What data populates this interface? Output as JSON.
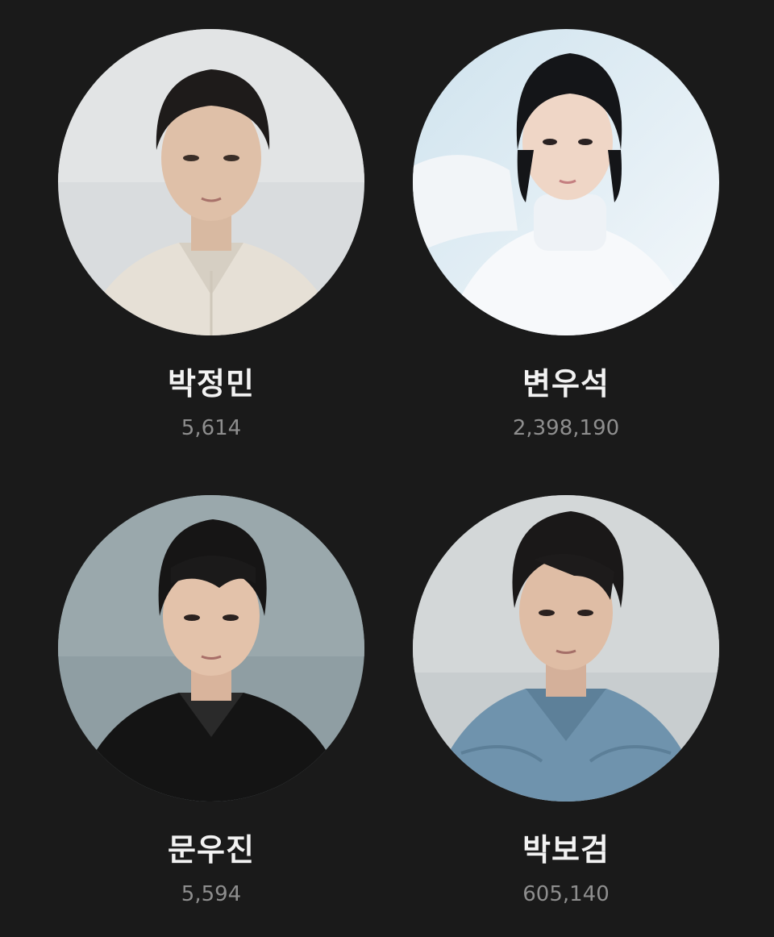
{
  "people": [
    {
      "name": "박정민",
      "count": "5,614",
      "photo": "portrait-light-shirt"
    },
    {
      "name": "변우석",
      "count": "2,398,190",
      "photo": "portrait-white-turtleneck"
    },
    {
      "name": "문우진",
      "count": "5,594",
      "photo": "portrait-black-shirt"
    },
    {
      "name": "박보검",
      "count": "605,140",
      "photo": "portrait-denim-shirt"
    }
  ],
  "colors": {
    "background": "#1a1a1a",
    "name_text": "#f2f2f2",
    "count_text": "#8e8e8e"
  }
}
